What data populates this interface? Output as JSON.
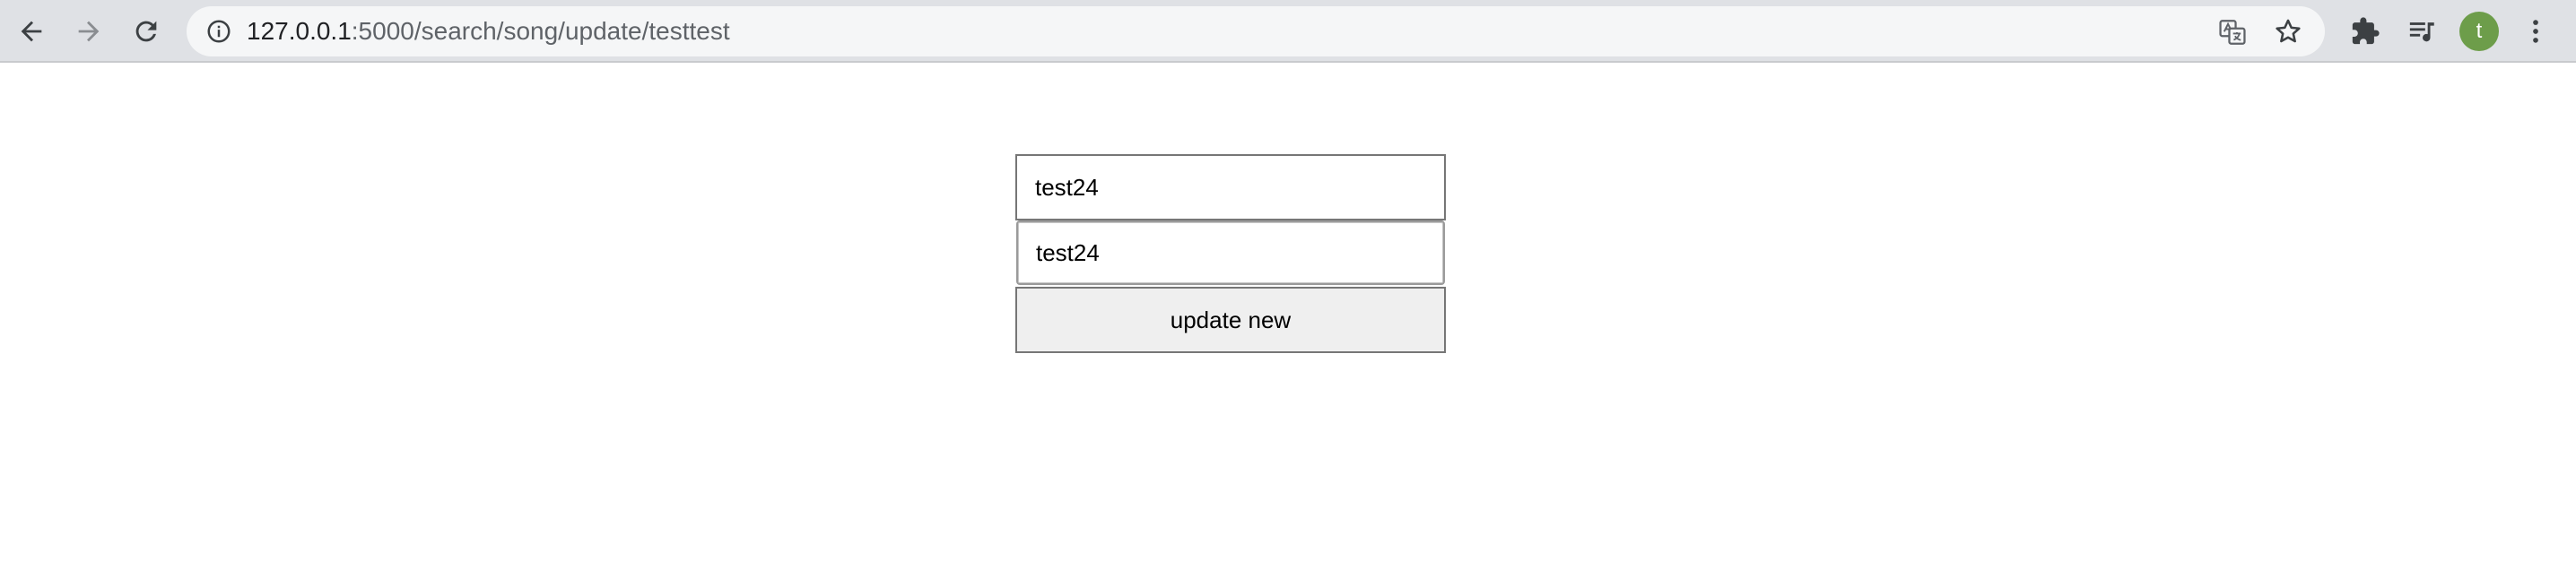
{
  "browser": {
    "url_host": "127.0.0.1",
    "url_path": ":5000/search/song/update/testtest",
    "profile_initial": "t",
    "profile_color": "#6d9d4a"
  },
  "form": {
    "field1_value": "test24",
    "field2_value": "test24",
    "submit_label": "update new"
  },
  "icons": {
    "back": "arrow-left",
    "forward": "arrow-right",
    "reload": "reload",
    "info": "info-circle",
    "translate": "translate",
    "bookmark": "star-outline",
    "extensions": "puzzle-piece",
    "media": "music-queue",
    "menu": "vertical-dots"
  }
}
